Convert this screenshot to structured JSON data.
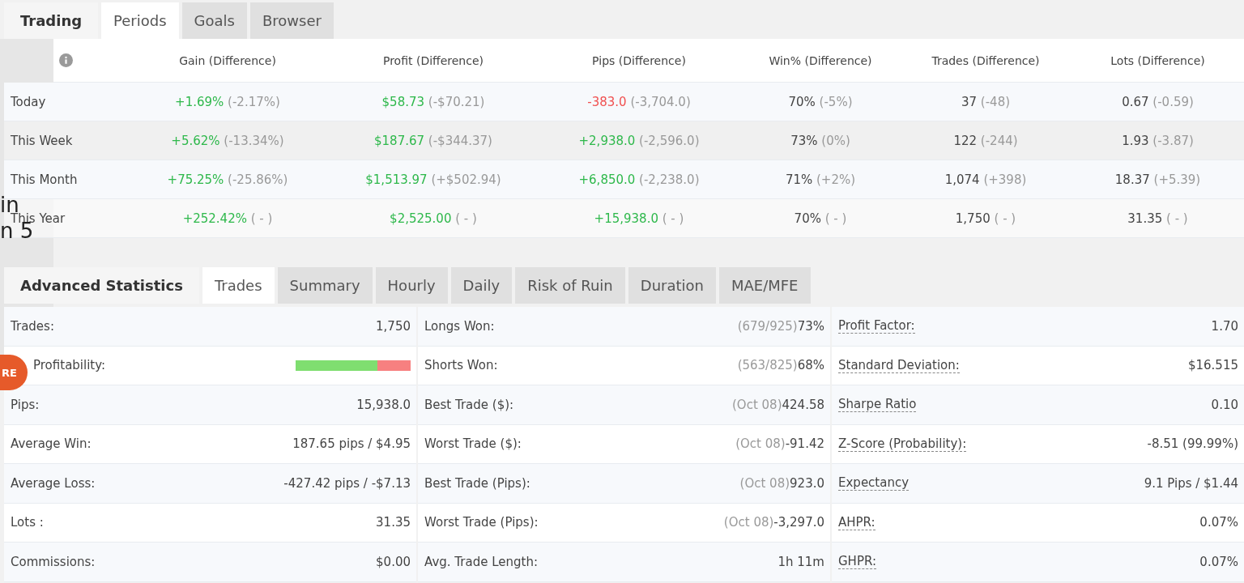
{
  "backdrop": {
    "fragments": [
      "in",
      "n 5"
    ],
    "badge": "RE"
  },
  "periods": {
    "title": "Trading",
    "tabs": [
      {
        "label": "Periods",
        "selected": true
      },
      {
        "label": "Goals",
        "selected": false
      },
      {
        "label": "Browser",
        "selected": false
      }
    ],
    "columns": [
      "Gain (Difference)",
      "Profit (Difference)",
      "Pips (Difference)",
      "Win% (Difference)",
      "Trades (Difference)",
      "Lots (Difference)"
    ],
    "rows": [
      {
        "label": "Today",
        "cells": [
          {
            "value": "+1.69%",
            "diff": "(-2.17%)",
            "color": "#2eb84b"
          },
          {
            "value": "$58.73",
            "diff": "(-$70.21)",
            "color": "#2eb84b"
          },
          {
            "value": "-383.0",
            "diff": "(-3,704.0)",
            "color": "#f05050"
          },
          {
            "value": "70%",
            "diff": "(-5%)",
            "color": "#444444"
          },
          {
            "value": "37",
            "diff": "(-48)",
            "color": "#444444"
          },
          {
            "value": "0.67",
            "diff": "(-0.59)",
            "color": "#444444"
          }
        ]
      },
      {
        "label": "This Week",
        "cells": [
          {
            "value": "+5.62%",
            "diff": "(-13.34%)",
            "color": "#2eb84b"
          },
          {
            "value": "$187.67",
            "diff": "(-$344.37)",
            "color": "#2eb84b"
          },
          {
            "value": "+2,938.0",
            "diff": "(-2,596.0)",
            "color": "#2eb84b"
          },
          {
            "value": "73%",
            "diff": "(0%)",
            "color": "#444444"
          },
          {
            "value": "122",
            "diff": "(-244)",
            "color": "#444444"
          },
          {
            "value": "1.93",
            "diff": "(-3.87)",
            "color": "#444444"
          }
        ]
      },
      {
        "label": "This Month",
        "cells": [
          {
            "value": "+75.25%",
            "diff": "(-25.86%)",
            "color": "#2eb84b"
          },
          {
            "value": "$1,513.97",
            "diff": "(+$502.94)",
            "color": "#2eb84b"
          },
          {
            "value": "+6,850.0",
            "diff": "(-2,238.0)",
            "color": "#2eb84b"
          },
          {
            "value": "71%",
            "diff": "(+2%)",
            "color": "#444444"
          },
          {
            "value": "1,074",
            "diff": "(+398)",
            "color": "#444444"
          },
          {
            "value": "18.37",
            "diff": "(+5.39)",
            "color": "#444444"
          }
        ]
      },
      {
        "label": "This Year",
        "cells": [
          {
            "value": "+252.42%",
            "diff": "( - )",
            "color": "#2eb84b"
          },
          {
            "value": "$2,525.00",
            "diff": "( - )",
            "color": "#2eb84b"
          },
          {
            "value": "+15,938.0",
            "diff": "( - )",
            "color": "#2eb84b"
          },
          {
            "value": "70%",
            "diff": "( - )",
            "color": "#444444"
          },
          {
            "value": "1,750",
            "diff": "( - )",
            "color": "#444444"
          },
          {
            "value": "31.35",
            "diff": "( - )",
            "color": "#444444"
          }
        ]
      }
    ]
  },
  "statistics": {
    "title": "Advanced Statistics",
    "tabs": [
      {
        "label": "Trades",
        "selected": true
      },
      {
        "label": "Summary",
        "selected": false
      },
      {
        "label": "Hourly",
        "selected": false
      },
      {
        "label": "Daily",
        "selected": false
      },
      {
        "label": "Risk of Ruin",
        "selected": false
      },
      {
        "label": "Duration",
        "selected": false
      },
      {
        "label": "MAE/MFE",
        "selected": false
      }
    ],
    "rows": [
      [
        {
          "kind": "text",
          "label": "Trades:",
          "value": "1,750"
        },
        {
          "kind": "text",
          "label": "Longs Won:",
          "note": "(679/925)",
          "value": "73%"
        },
        {
          "kind": "text",
          "label": "Profit Factor:",
          "dotted": true,
          "value": "1.70"
        }
      ],
      [
        {
          "kind": "bar",
          "label": "Profitability:",
          "level": 0.71
        },
        {
          "kind": "text",
          "label": "Shorts Won:",
          "note": "(563/825)",
          "value": "68%"
        },
        {
          "kind": "text",
          "label": "Standard Deviation:",
          "dotted": true,
          "value": "$16.515"
        }
      ],
      [
        {
          "kind": "text",
          "label": "Pips:",
          "value": "15,938.0"
        },
        {
          "kind": "text",
          "label": "Best Trade ($):",
          "note": "(Oct 08)",
          "value": "424.58"
        },
        {
          "kind": "text",
          "label": "Sharpe Ratio",
          "dotted": true,
          "value": "0.10"
        }
      ],
      [
        {
          "kind": "text",
          "label": "Average Win:",
          "value": "187.65 pips / $4.95"
        },
        {
          "kind": "text",
          "label": "Worst Trade ($):",
          "note": "(Oct 08)",
          "value": "-91.42"
        },
        {
          "kind": "text",
          "label": "Z-Score (Probability):",
          "dotted": true,
          "value": "-8.51 (99.99%)"
        }
      ],
      [
        {
          "kind": "text",
          "label": "Average Loss:",
          "value": "-427.42 pips / -$7.13"
        },
        {
          "kind": "text",
          "label": "Best Trade (Pips):",
          "note": "(Oct 08)",
          "value": "923.0"
        },
        {
          "kind": "text",
          "label": "Expectancy",
          "dotted": true,
          "value": "9.1 Pips / $1.44"
        }
      ],
      [
        {
          "kind": "text",
          "label": "Lots :",
          "value": "31.35"
        },
        {
          "kind": "text",
          "label": "Worst Trade (Pips):",
          "note": "(Oct 08)",
          "value": "-3,297.0"
        },
        {
          "kind": "text",
          "label": "AHPR:",
          "dotted": true,
          "value": "0.07%"
        }
      ],
      [
        {
          "kind": "text",
          "label": "Commissions:",
          "value": "$0.00"
        },
        {
          "kind": "text",
          "label": "Avg. Trade Length:",
          "value": "1h 11m"
        },
        {
          "kind": "text",
          "label": "GHPR:",
          "dotted": true,
          "value": "0.07%"
        }
      ]
    ]
  }
}
